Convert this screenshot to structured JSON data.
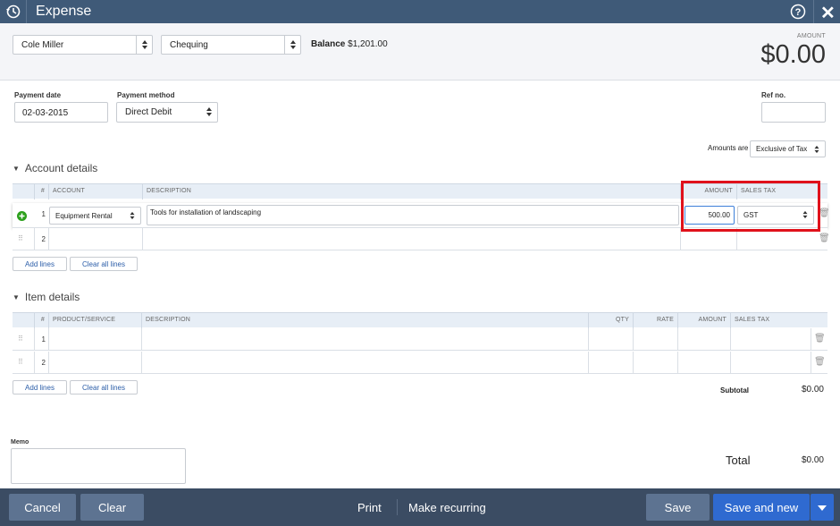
{
  "header": {
    "title": "Expense",
    "close": "✕"
  },
  "top": {
    "payee": "Cole Miller",
    "account": "Chequing",
    "balance_label": "Balance",
    "balance_value": "$1,201.00",
    "amount_label": "AMOUNT",
    "amount_value": "$0.00"
  },
  "payment": {
    "date_label": "Payment date",
    "date_value": "02-03-2015",
    "method_label": "Payment method",
    "method_value": "Direct Debit",
    "ref_label": "Ref no.",
    "ref_value": ""
  },
  "amounts_are": {
    "label": "Amounts are",
    "value": "Exclusive of Tax"
  },
  "account_details": {
    "title": "Account details",
    "headers": {
      "num": "#",
      "account": "ACCOUNT",
      "description": "DESCRIPTION",
      "amount": "AMOUNT",
      "sales_tax": "SALES TAX"
    },
    "rows": [
      {
        "num": "1",
        "account": "Equipment Rental",
        "description": "Tools for installation of landscaping",
        "amount": "500.00",
        "tax": "GST"
      },
      {
        "num": "2",
        "account": "",
        "description": "",
        "amount": "",
        "tax": ""
      }
    ],
    "add_lines": "Add lines",
    "clear_lines": "Clear all lines"
  },
  "item_details": {
    "title": "Item details",
    "headers": {
      "num": "#",
      "product": "PRODUCT/SERVICE",
      "description": "DESCRIPTION",
      "qty": "QTY",
      "rate": "RATE",
      "amount": "AMOUNT",
      "sales_tax": "SALES TAX"
    },
    "rows": [
      {
        "num": "1"
      },
      {
        "num": "2"
      }
    ],
    "add_lines": "Add lines",
    "clear_lines": "Clear all lines",
    "subtotal_label": "Subtotal",
    "subtotal_value": "$0.00"
  },
  "memo": {
    "label": "Memo",
    "value": ""
  },
  "total": {
    "label": "Total",
    "value": "$0.00"
  },
  "footer": {
    "cancel": "Cancel",
    "clear": "Clear",
    "print": "Print",
    "recurring": "Make recurring",
    "save": "Save",
    "save_new": "Save and new"
  },
  "colors": {
    "header": "#3f5a78",
    "footer": "#3b4c63",
    "primary": "#2f6ad0",
    "highlight": "#e0111b"
  }
}
